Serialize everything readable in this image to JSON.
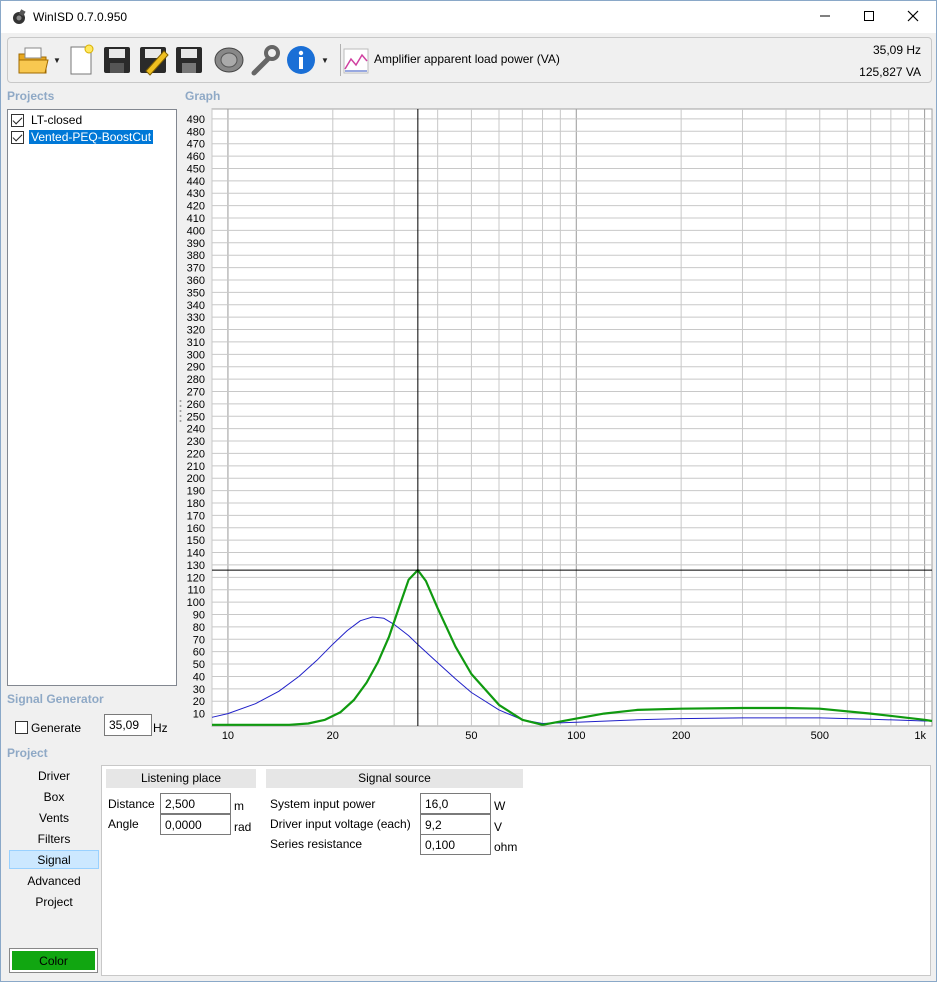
{
  "window": {
    "title": "WinISD 0.7.0.950"
  },
  "toolbar": {
    "graph_type": "Amplifier apparent load power (VA)",
    "cursor_freq": "35,09 Hz",
    "cursor_value": "125,827 VA"
  },
  "sections": {
    "projects": "Projects",
    "graph": "Graph",
    "signal_generator": "Signal Generator",
    "project": "Project"
  },
  "projects": [
    {
      "name": "LT-closed",
      "checked": true,
      "selected": false
    },
    {
      "name": "Vented-PEQ-BoostCut",
      "checked": true,
      "selected": true
    }
  ],
  "signal_generator": {
    "generate_label": "Generate",
    "frequency": "35,09",
    "unit": "Hz"
  },
  "nav": [
    "Driver",
    "Box",
    "Vents",
    "Filters",
    "Signal",
    "Advanced",
    "Project"
  ],
  "nav_selected": "Signal",
  "color_button": "Color",
  "signal_tab": {
    "listening_header": "Listening place",
    "source_header": "Signal source",
    "distance_label": "Distance",
    "distance_value": "2,500",
    "distance_unit": "m",
    "angle_label": "Angle",
    "angle_value": "0,0000",
    "angle_unit": "rad",
    "power_label": "System input power",
    "power_value": "16,0",
    "power_unit": "W",
    "voltage_label": "Driver input voltage (each)",
    "voltage_value": "9,2",
    "voltage_unit": "V",
    "resistance_label": "Series resistance",
    "resistance_value": "0,100",
    "resistance_unit": "ohm"
  },
  "chart_data": {
    "type": "line",
    "x_scale": "log",
    "xlim": [
      9,
      1050
    ],
    "ylim": [
      0,
      498
    ],
    "x_tick_labels": [
      {
        "v": 10,
        "t": "10"
      },
      {
        "v": 20,
        "t": "20"
      },
      {
        "v": 50,
        "t": "50"
      },
      {
        "v": 100,
        "t": "100"
      },
      {
        "v": 200,
        "t": "200"
      },
      {
        "v": 500,
        "t": "500"
      },
      {
        "v": 1000,
        "t": "1k"
      }
    ],
    "y_ticks_step": 10,
    "y_ticks_from": 10,
    "y_ticks_to": 490,
    "grid": true,
    "cursor": {
      "x": 35.09,
      "y": 125.827
    },
    "series": [
      {
        "color": "#2020c8",
        "width": 1,
        "x": [
          9,
          10,
          12,
          14,
          16,
          18,
          20,
          22,
          24,
          26,
          28,
          30,
          33,
          35,
          40,
          45,
          50,
          60,
          70,
          80,
          100,
          150,
          200,
          300,
          400,
          500,
          700,
          1000,
          1050
        ],
        "y": [
          7,
          10,
          18,
          28,
          40,
          53,
          66,
          77,
          85,
          88,
          87,
          82,
          73,
          66,
          51,
          38,
          27,
          13,
          5,
          2,
          3,
          5,
          6,
          6.5,
          6.5,
          6.5,
          5.5,
          4,
          4
        ]
      },
      {
        "color": "#109a10",
        "width": 2.2,
        "x": [
          9,
          12,
          15,
          17,
          19,
          21,
          23,
          25,
          27,
          29,
          31,
          33,
          35.09,
          37,
          40,
          45,
          50,
          60,
          70,
          80,
          100,
          120,
          150,
          200,
          300,
          400,
          500,
          700,
          1000,
          1050
        ],
        "y": [
          1,
          1,
          1,
          2,
          5,
          11,
          21,
          35,
          52,
          72,
          96,
          118,
          125.8,
          117,
          95,
          64,
          42,
          17,
          5,
          1,
          6,
          10,
          13,
          14,
          14.5,
          14.5,
          14,
          10,
          5,
          4
        ]
      }
    ]
  }
}
